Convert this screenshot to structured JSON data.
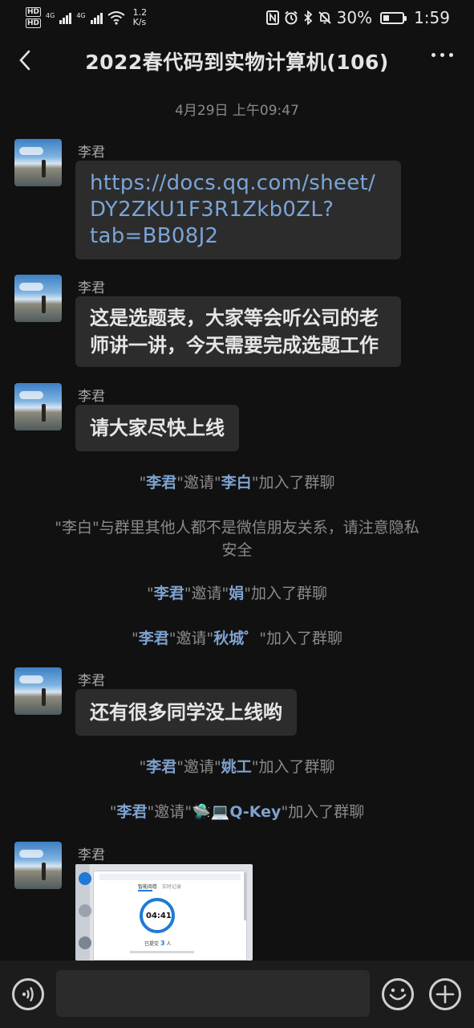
{
  "status_bar": {
    "hd1": "HD",
    "hd2": "HD",
    "net1": "4G",
    "net2": "4G",
    "speed_value": "1.2",
    "speed_unit": "K/s",
    "battery_percent": "30%",
    "battery_level": 0.3,
    "time": "1:59"
  },
  "header": {
    "title": "2022春代码到实物计算机(106)"
  },
  "timestamp": "4月29日 上午09:47",
  "messages": [
    {
      "sender": "李君",
      "lines": [
        "https://docs.qq.com/sheet/",
        "DY2ZKU1F3R1Zkb0ZL?",
        "tab=BB08J2"
      ]
    },
    {
      "sender": "李君",
      "lines": [
        "这是选题表，大家等会听公司的老",
        "师讲一讲，今天需要完成选题工作"
      ]
    },
    {
      "sender": "李君",
      "text": "请大家尽快上线"
    },
    {
      "sender": "李君",
      "text": "还有很多同学没上线哟"
    },
    {
      "sender": "李君",
      "image_alt": "screenshot"
    }
  ],
  "system": {
    "q": "\"",
    "invite": "邀请",
    "joined": "加入了群聊",
    "inviter": "李君",
    "s1_invitee": "李白",
    "s2_line1": "\"李白\"与群里其他人都不是微信朋友关系，请注意隐私",
    "s2_line2": "安全",
    "s3_invitee": "娟",
    "s4_invitee": "秋城゜",
    "s5_invitee": "姚工",
    "s6_invitee": "🛸💻Q-Key"
  },
  "thumb": {
    "tab1": "智能阅卷",
    "tab2": "实时记录",
    "timer": "04:41",
    "count_label": "已提交",
    "count": "3",
    "count_unit": "人"
  },
  "input": {
    "value": ""
  },
  "icons": {
    "back": "chevron-left-icon",
    "more": "more-dots-icon",
    "voice": "voice-icon",
    "emoji": "emoji-icon",
    "plus": "plus-icon"
  }
}
